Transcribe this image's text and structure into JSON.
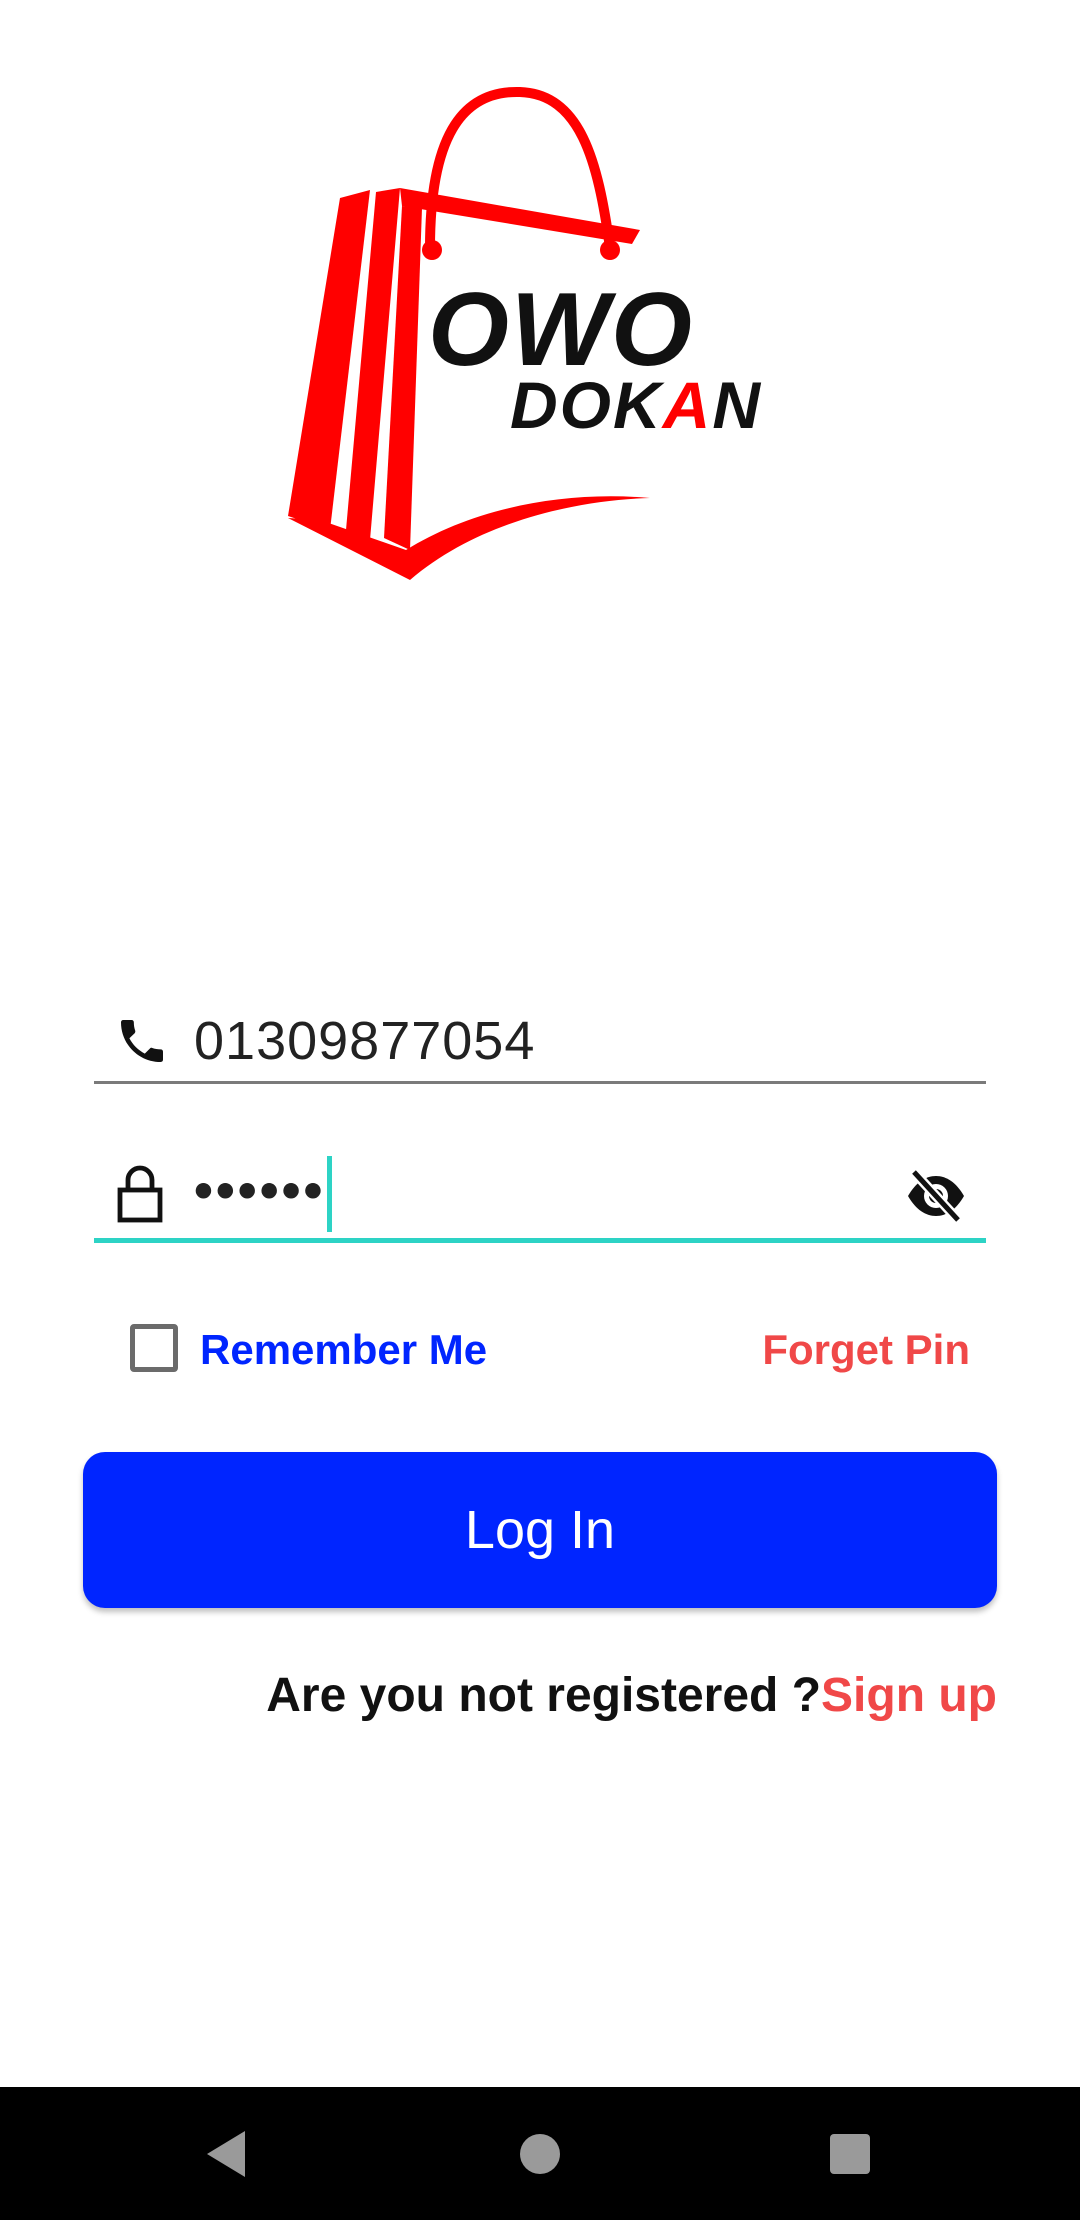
{
  "logo": {
    "word1": "OWO",
    "word2_part1": "DOK",
    "word2_accent": "A",
    "word2_part2": "N",
    "colors": {
      "bag": "#ff0000",
      "text": "#111111"
    }
  },
  "form": {
    "phone": {
      "value": "01309877054",
      "icon": "phone-icon"
    },
    "pin": {
      "value": "••••••",
      "icon": "lock-icon",
      "toggle_icon": "eye-off-icon"
    },
    "remember_label": "Remember Me",
    "remember_checked": false,
    "forget_label": "Forget Pin",
    "login_label": "Log In",
    "register_question": "Are you not registered ?",
    "signup_label": "Sign up"
  },
  "navbar": {
    "back_icon": "back-triangle-icon",
    "home_icon": "home-circle-icon",
    "recent_icon": "recents-square-icon"
  },
  "colors": {
    "primary": "#0025ff",
    "accent_red": "#f04848",
    "focus_teal": "#2dd3c5"
  }
}
